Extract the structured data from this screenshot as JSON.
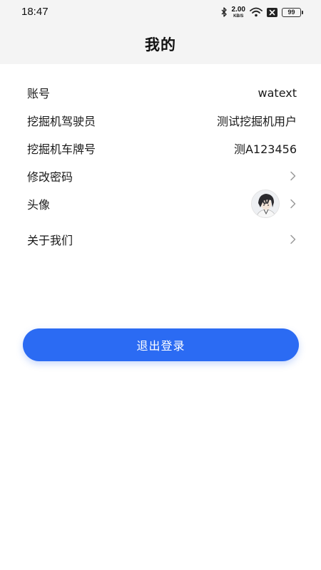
{
  "status_bar": {
    "time": "18:47",
    "net_speed_value": "2.00",
    "net_speed_unit": "KB/S",
    "battery": "99",
    "icons": [
      "bluetooth-icon",
      "wifi-icon",
      "x-icon",
      "battery-icon"
    ]
  },
  "header": {
    "title": "我的"
  },
  "profile": {
    "account": {
      "label": "账号",
      "value": "watext"
    },
    "driver": {
      "label": "挖掘机驾驶员",
      "value": "测试挖掘机用户"
    },
    "plate": {
      "label": "挖掘机车牌号",
      "value": "测A123456"
    },
    "password": {
      "label": "修改密码"
    },
    "avatar": {
      "label": "头像"
    },
    "about": {
      "label": "关于我们"
    }
  },
  "logout": {
    "label": "退出登录"
  },
  "colors": {
    "accent": "#2b6bf3",
    "header_bg": "#f4f4f4"
  }
}
